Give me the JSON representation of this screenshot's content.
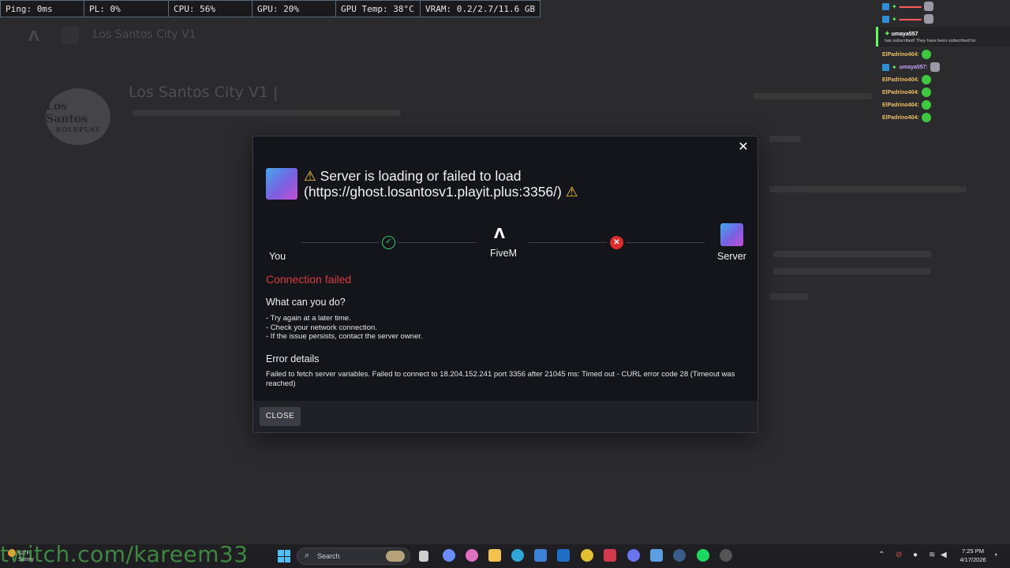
{
  "perf": {
    "ping": "Ping: 0ms",
    "pl": "PL: 0%",
    "cpu": "CPU: 56%",
    "gpu": "GPU: 20%",
    "gpu_temp": "GPU Temp: 38°C",
    "vram": "VRAM: 0.2/2.7/11.6 GB"
  },
  "background": {
    "tab_title": "Los Santos City V1",
    "server_title": "Los Santos City V1 |",
    "logo_line1": "Los Santos",
    "logo_line2": "ROLEPLAY"
  },
  "chat": {
    "sub_user": "umaya557",
    "sub_message": "has subscribed! They have been subscribed for",
    "user1": "ElPadrino404:",
    "user2": "umaya557:"
  },
  "modal": {
    "title": "Server is loading or failed to load (https://ghost.losantosv1.playit.plus:3356/)",
    "warn_glyph": "⚠",
    "you_label": "You",
    "fivem_label": "FiveM",
    "server_label": "Server",
    "status": "Connection failed",
    "what_heading": "What can you do?",
    "tips": [
      "- Try again at a later time.",
      "- Check your network connection.",
      "- If the issue persists, contact the server owner."
    ],
    "error_heading": "Error details",
    "error_text": "Failed to fetch server variables. Failed to connect to 18.204.152.241 port 3356 after 21045 ms: Timed out - CURL error code 28 (Timeout was reached)",
    "close_label": "CLOSE"
  },
  "taskbar": {
    "weather_temp": "62°F",
    "weather_desc": "Sunny",
    "search_placeholder": "Search",
    "time": "7:25 PM",
    "date": "4/17/2026"
  },
  "watermark": "twitch.com/kareem33",
  "colors": {
    "error": "#d83b3b",
    "success": "#2fc86a",
    "warning": "#f5c542",
    "accent": "#4cc2ff"
  }
}
